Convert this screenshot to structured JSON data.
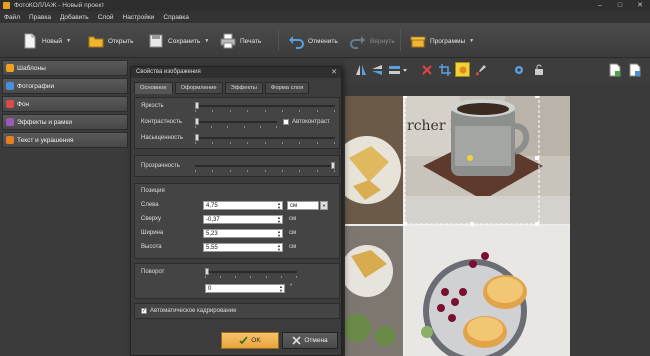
{
  "window": {
    "title": "ФотоКОЛЛАЖ - Новый проект",
    "controls": [
      "–",
      "□",
      "✕"
    ]
  },
  "menu": [
    "Файл",
    "Правка",
    "Добавить",
    "Слой",
    "Настройки",
    "Справка"
  ],
  "toolbar": {
    "new_label": "Новый",
    "open_label": "Открыть",
    "save_label": "Сохранить",
    "print_label": "Печать",
    "undo_label": "Отменить",
    "redo_label": "Вернуть",
    "programs_label": "Программы"
  },
  "left_panel": {
    "items": [
      {
        "label": "Шаблоны",
        "icon": "star-icon",
        "color": "#f0a020"
      },
      {
        "label": "Фотографии",
        "icon": "photo-icon",
        "color": "#4a90d9"
      },
      {
        "label": "Фон",
        "icon": "background-icon",
        "color": "#d94a4a"
      },
      {
        "label": "Эффекты и рамки",
        "icon": "effects-icon",
        "color": "#9b59b6"
      },
      {
        "label": "Текст и украшения",
        "icon": "text-icon",
        "color": "#e67e22"
      }
    ]
  },
  "dialog": {
    "title": "Свойства изображения",
    "close": "✕",
    "tabs": [
      "Основное",
      "Оформление",
      "Эффекты",
      "Форма слоя"
    ],
    "brightness_label": "Яркость",
    "contrast_label": "Контрастность",
    "autocontrast_label": "Автоконтраст",
    "saturation_label": "Насыщенность",
    "transparency_label": "Прозрачность",
    "position_label": "Позиция",
    "left_label": "Слева",
    "left_value": "4,75",
    "top_label": "Сверху",
    "top_value": "-0,37",
    "width_label": "Ширина",
    "width_value": "5,23",
    "height_label": "Высота",
    "height_value": "5,55",
    "unit_select": "см",
    "unit": "см",
    "rotation_label": "Поворот",
    "rotation_value": "0",
    "rotation_unit": "°",
    "autocrop_label": "Автоматическое кадрирование",
    "autocrop_checked": "✓",
    "ok_label": "OK",
    "cancel_label": "Отмена",
    "brightness_level": 0.0,
    "contrast_level": 0.0,
    "saturation_level": 0.0,
    "transparency_level": 1.0,
    "rotation_level": 0.0
  },
  "canvas": {
    "newspaper_text": "rcher Zeit"
  }
}
